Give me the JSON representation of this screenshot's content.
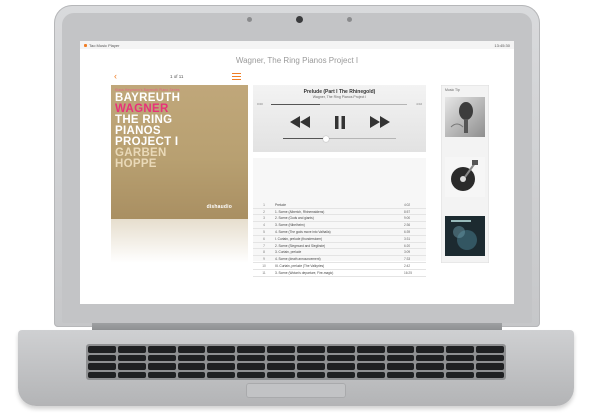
{
  "statusbar": {
    "app_name": "Tao Music Player",
    "clock": "13:45:30"
  },
  "app": {
    "title": "Wagner, The Ring Pianos Project I"
  },
  "header": {
    "back_icon": "chevron-left-icon",
    "page_indicator": "1 of 11",
    "menu_icon": "hamburger-icon",
    "accent_color": "#f07e26"
  },
  "album": {
    "series_line": "Klaus Heymann's Bayreuth Piano Series",
    "title_lines": [
      {
        "text": "BAYREUTH",
        "color": "#ffffff"
      },
      {
        "text": "WAGNER",
        "color": "#e8317a"
      },
      {
        "text": "THE RING",
        "color": "#ffffff"
      },
      {
        "text": "PIANOS",
        "color": "#ffffff"
      },
      {
        "text": "PROJECT I",
        "color": "#ffffff"
      },
      {
        "text": "GARBEN",
        "color": "#e9d9b8"
      },
      {
        "text": "HOPPE",
        "color": "#e9d9b8"
      }
    ],
    "label": "dishaudio"
  },
  "player": {
    "track_title": "Prelude (Part I The Rhinegold)",
    "track_subtitle": "Wagner, The Ring Pianos Project I",
    "elapsed": "0:00",
    "total": "4:02",
    "progress": 0.36,
    "volume": 0.38,
    "controls": {
      "rewind_icon": "rewind-icon",
      "pause_icon": "pause-icon",
      "forward_icon": "fast-forward-icon"
    }
  },
  "tracks": [
    {
      "num": "1",
      "name": "Prelude",
      "duration": "4:02"
    },
    {
      "num": "2",
      "name": "1. Scene (Alberich, Rhinemaidens)",
      "duration": "8:57"
    },
    {
      "num": "3",
      "name": "2. Scene (Gods and giants)",
      "duration": "9:00"
    },
    {
      "num": "4",
      "name": "3. Scene (Nibelheim)",
      "duration": "2:36"
    },
    {
      "num": "5",
      "name": "4. Scene (The gods move into Valhalla)",
      "duration": "6:39"
    },
    {
      "num": "6",
      "name": "I. Curtain, prelude (thunderstorm)",
      "duration": "3:31"
    },
    {
      "num": "7",
      "name": "2. Scene (Siegmund and Sieglinde)",
      "duration": "6:20"
    },
    {
      "num": "8",
      "name": "3. Curtain, prelude",
      "duration": "3:09"
    },
    {
      "num": "9",
      "name": "4. Scene (death announcement)",
      "duration": "7:33"
    },
    {
      "num": "10",
      "name": "III. Curtain, prelude (The Valkyries)",
      "duration": "2:42"
    },
    {
      "num": "11",
      "name": "3. Scene (Wotan's departure, Fire-magic)",
      "duration": "16:25"
    }
  ],
  "music_tip": {
    "label": "Music Tip",
    "items": [
      {
        "icon": "microphone-icon"
      },
      {
        "icon": "record-player-icon"
      },
      {
        "icon": "album-cover-icon"
      }
    ]
  }
}
